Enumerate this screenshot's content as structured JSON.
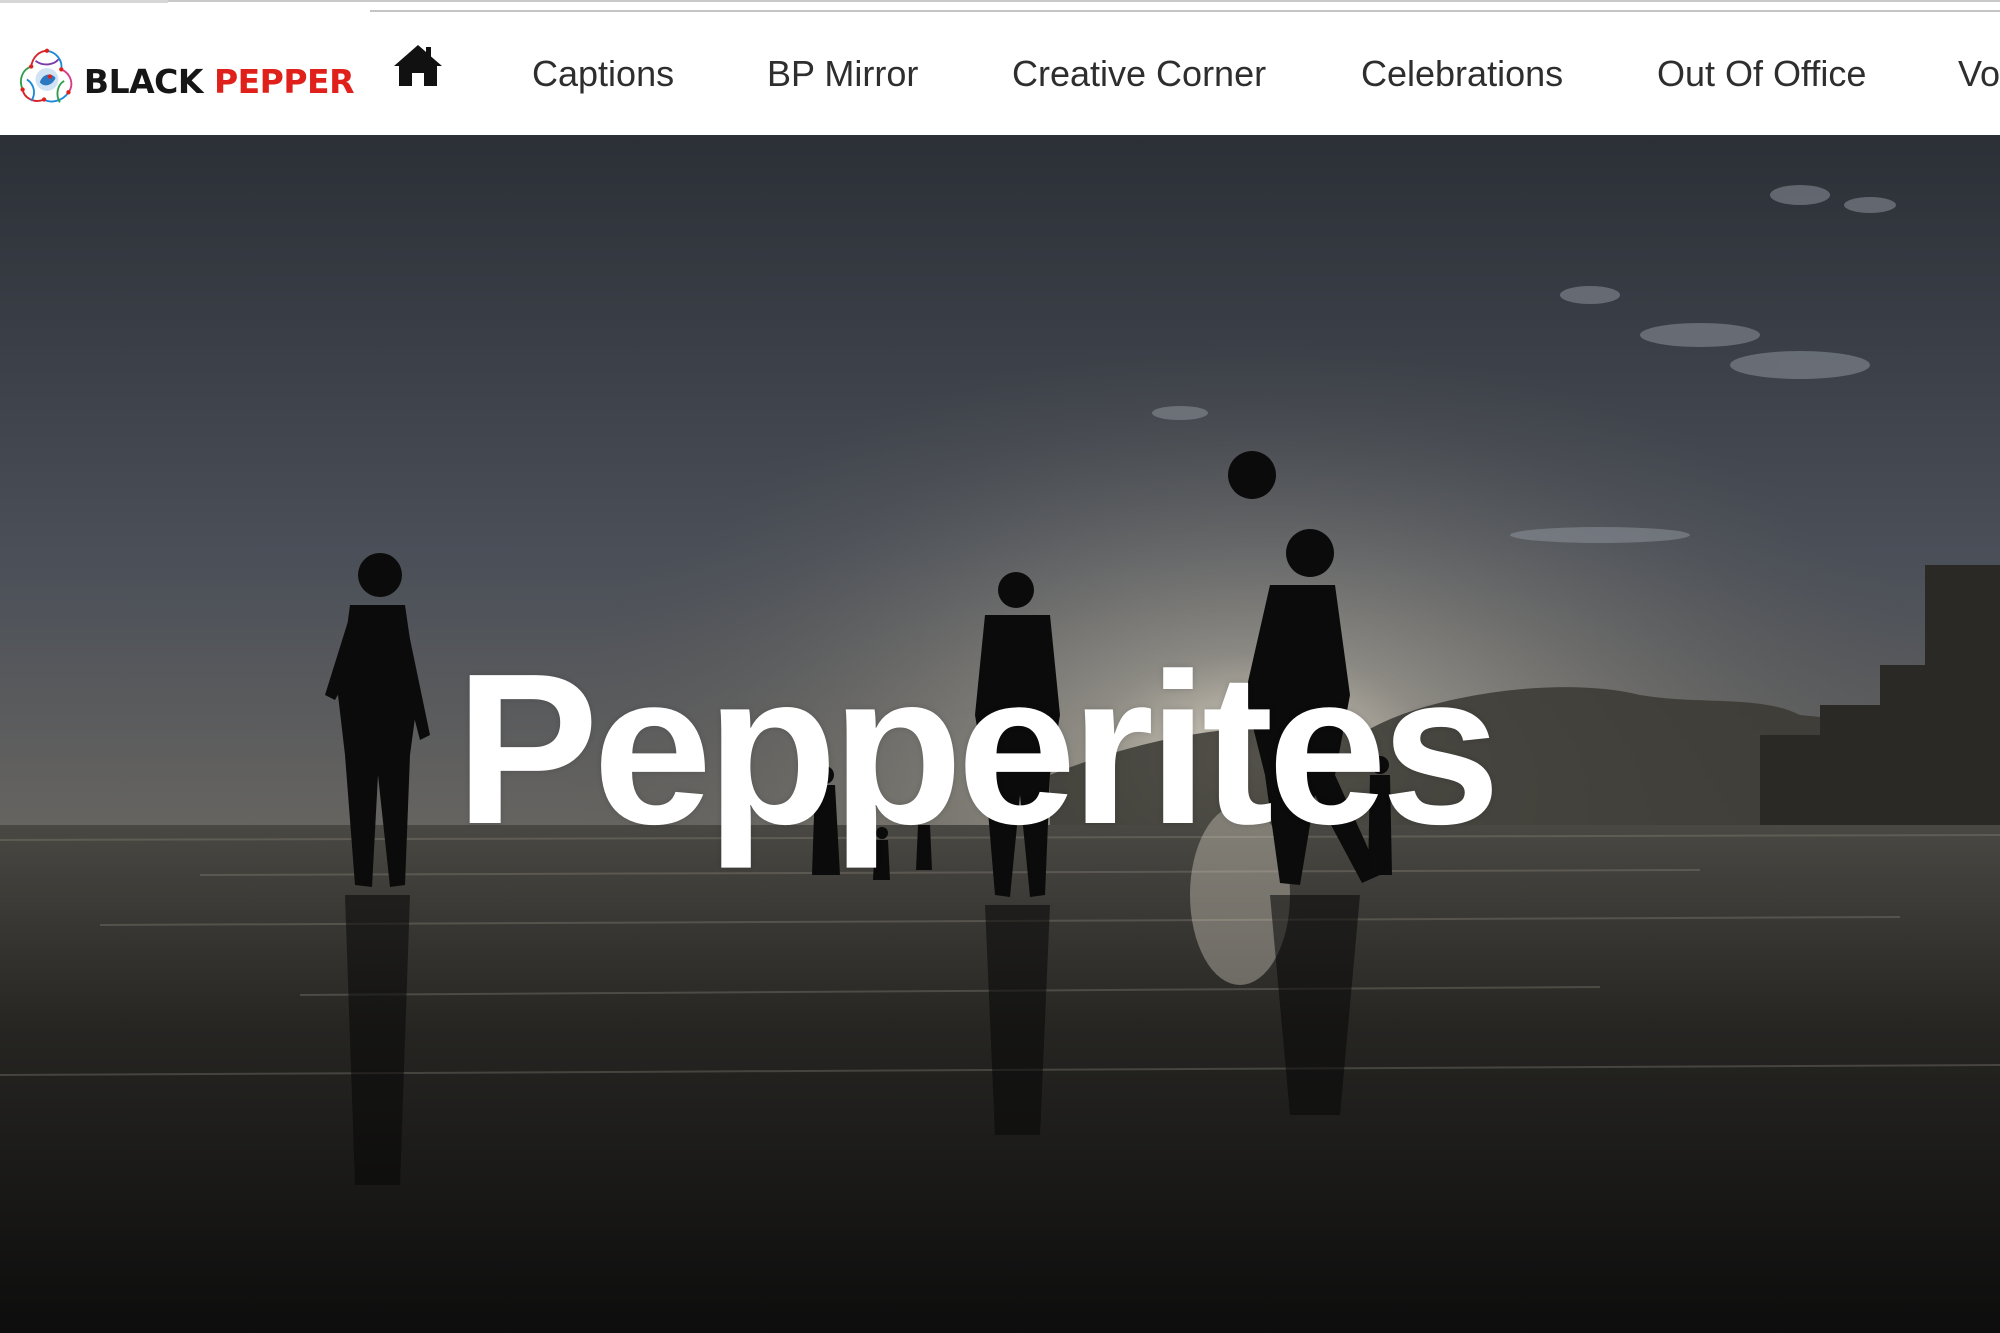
{
  "brand": {
    "name_part1": "BLACK",
    "name_part2": "PEPPER",
    "accent_color": "#e0211b"
  },
  "nav": {
    "home_icon": "home-icon",
    "items": [
      "Captions",
      "BP Mirror",
      "Creative Corner",
      "Celebrations",
      "Out Of Office",
      "Vo"
    ]
  },
  "hero": {
    "title": "Pepperites"
  }
}
